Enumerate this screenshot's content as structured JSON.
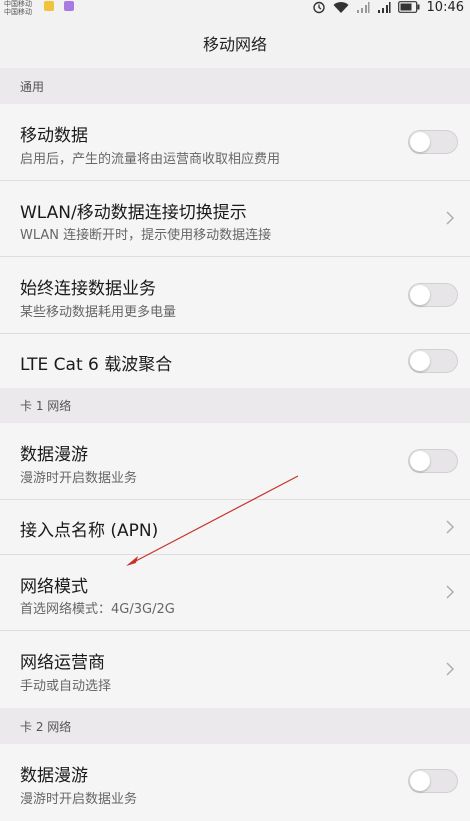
{
  "status_bar": {
    "carrier_1": "中国移动",
    "carrier_2": "中国移动",
    "time": "10:46",
    "icons": [
      "alarm-icon",
      "wifi-icon",
      "signal-icon",
      "signal-icon",
      "battery-icon"
    ]
  },
  "title": "移动网络",
  "sections": {
    "general": "通用",
    "sim1": "卡 1 网络",
    "sim2": "卡 2 网络"
  },
  "rows": {
    "mobile_data": {
      "title": "移动数据",
      "subtitle": "启用后，产生的流量将由运营商收取相应费用",
      "toggle_on": false
    },
    "wlan_switch": {
      "title": "WLAN/移动数据连接切换提示",
      "subtitle": "WLAN 连接断开时，提示使用移动数据连接"
    },
    "always_on": {
      "title": "始终连接数据业务",
      "subtitle": "某些移动数据耗用更多电量",
      "toggle_on": false
    },
    "lte_ca": {
      "title": "LTE Cat 6 载波聚合",
      "toggle_on": false
    },
    "roaming1": {
      "title": "数据漫游",
      "subtitle": "漫游时开启数据业务",
      "toggle_on": false
    },
    "apn": {
      "title": "接入点名称 (APN)"
    },
    "network_mode": {
      "title": "网络模式",
      "subtitle": "首选网络模式：4G/3G/2G"
    },
    "operator": {
      "title": "网络运营商",
      "subtitle": "手动或自动选择"
    },
    "roaming2": {
      "title": "数据漫游",
      "subtitle": "漫游时开启数据业务",
      "toggle_on": false
    }
  },
  "colors": {
    "annotation_arrow": "#c8322a",
    "background": "#f3f2f3",
    "section_background": "#ebe9eb"
  }
}
